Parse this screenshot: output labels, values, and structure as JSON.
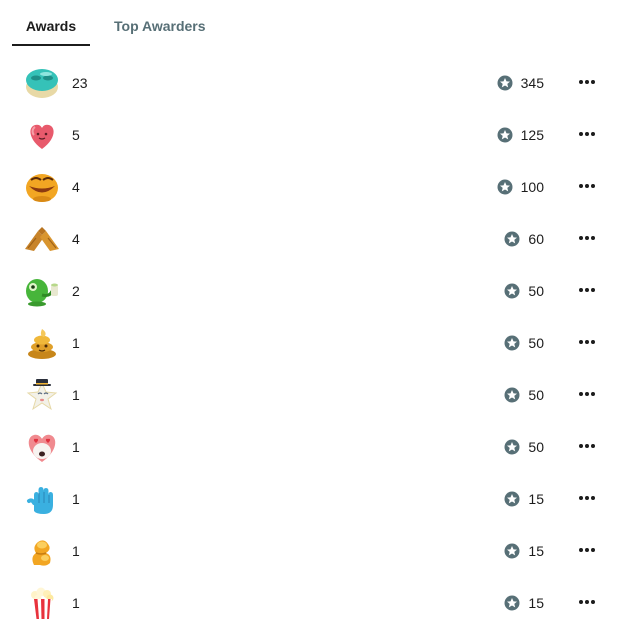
{
  "tabs": [
    {
      "label": "Awards"
    },
    {
      "label": "Top Awarders"
    }
  ],
  "awards": [
    {
      "icon": "sleepy-blob-icon",
      "count": "23",
      "price": "345"
    },
    {
      "icon": "wholesome-heart-icon",
      "count": "5",
      "price": "125"
    },
    {
      "icon": "laughing-face-icon",
      "count": "4",
      "price": "100"
    },
    {
      "icon": "clapping-hands-icon",
      "count": "4",
      "price": "60"
    },
    {
      "icon": "green-creature-icon",
      "count": "2",
      "price": "50"
    },
    {
      "icon": "golden-poop-icon",
      "count": "1",
      "price": "50"
    },
    {
      "icon": "star-gentleman-icon",
      "count": "1",
      "price": "50"
    },
    {
      "icon": "heart-eyes-icon",
      "count": "1",
      "price": "50"
    },
    {
      "icon": "blue-hand-icon",
      "count": "1",
      "price": "15"
    },
    {
      "icon": "gold-flex-icon",
      "count": "1",
      "price": "15"
    },
    {
      "icon": "popcorn-icon",
      "count": "1",
      "price": "15"
    }
  ],
  "colors": {
    "text": "#1c1c1c",
    "tab_inactive": "#576f76",
    "coin_icon": "#576f76"
  }
}
